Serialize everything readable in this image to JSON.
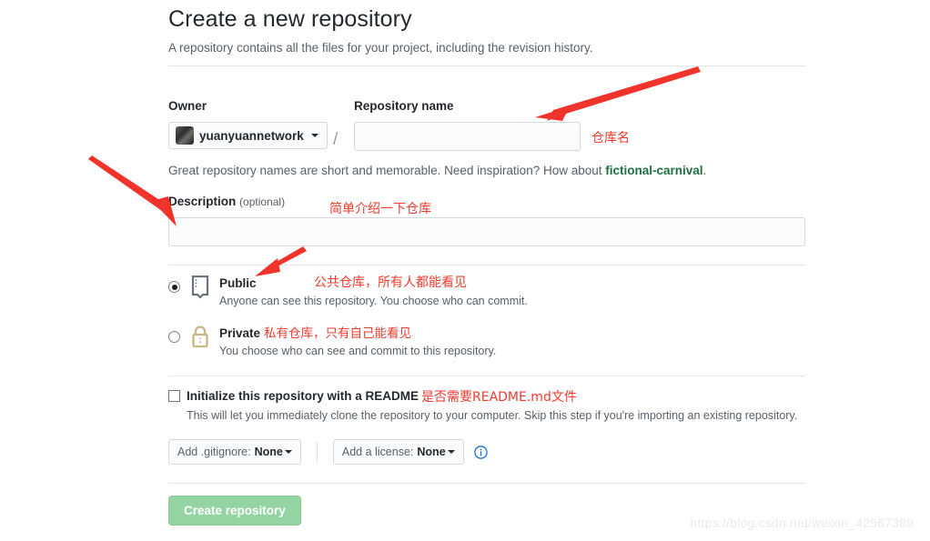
{
  "header": {
    "title": "Create a new repository",
    "subtitle": "A repository contains all the files for your project, including the revision history."
  },
  "form": {
    "owner_label": "Owner",
    "owner_value": "yuanyuannetwork",
    "separator": "/",
    "repo_name_label": "Repository name",
    "repo_name_value": "",
    "repo_name_placeholder": "",
    "hint_prefix": "Great repository names are short and memorable. Need inspiration? How about ",
    "hint_suggestion": "fictional-carnival",
    "hint_suffix": ".",
    "description_label": "Description",
    "description_optional": "(optional)",
    "description_value": "",
    "description_placeholder": ""
  },
  "visibility": {
    "public": {
      "title": "Public",
      "description": "Anyone can see this repository. You choose who can commit.",
      "selected": true,
      "icon": "repo-icon",
      "icon_color": "#6a737d"
    },
    "private": {
      "title": "Private",
      "description": "You choose who can see and commit to this repository.",
      "selected": false,
      "icon": "lock-icon",
      "icon_color": "#c9b885"
    }
  },
  "readme": {
    "label": "Initialize this repository with a README",
    "description": "This will let you immediately clone the repository to your computer. Skip this step if you're importing an existing repository.",
    "checked": false
  },
  "selects": {
    "gitignore_label": "Add .gitignore:",
    "gitignore_value": "None",
    "license_label": "Add a license:",
    "license_value": "None",
    "info_icon": "info-icon"
  },
  "actions": {
    "create_label": "Create repository",
    "create_color": "#94d3a2",
    "create_disabled": true
  },
  "annotations": {
    "repo_name": "仓库名",
    "description": "简单介绍一下仓库",
    "public": "公共仓库，所有人都能看见",
    "private": "私有仓库，只有自己能看见",
    "readme": "是否需要README.md文件",
    "color": "#ef3b2d"
  },
  "watermark": {
    "text": "https://blog.csdn.net/weixin_42567389"
  }
}
